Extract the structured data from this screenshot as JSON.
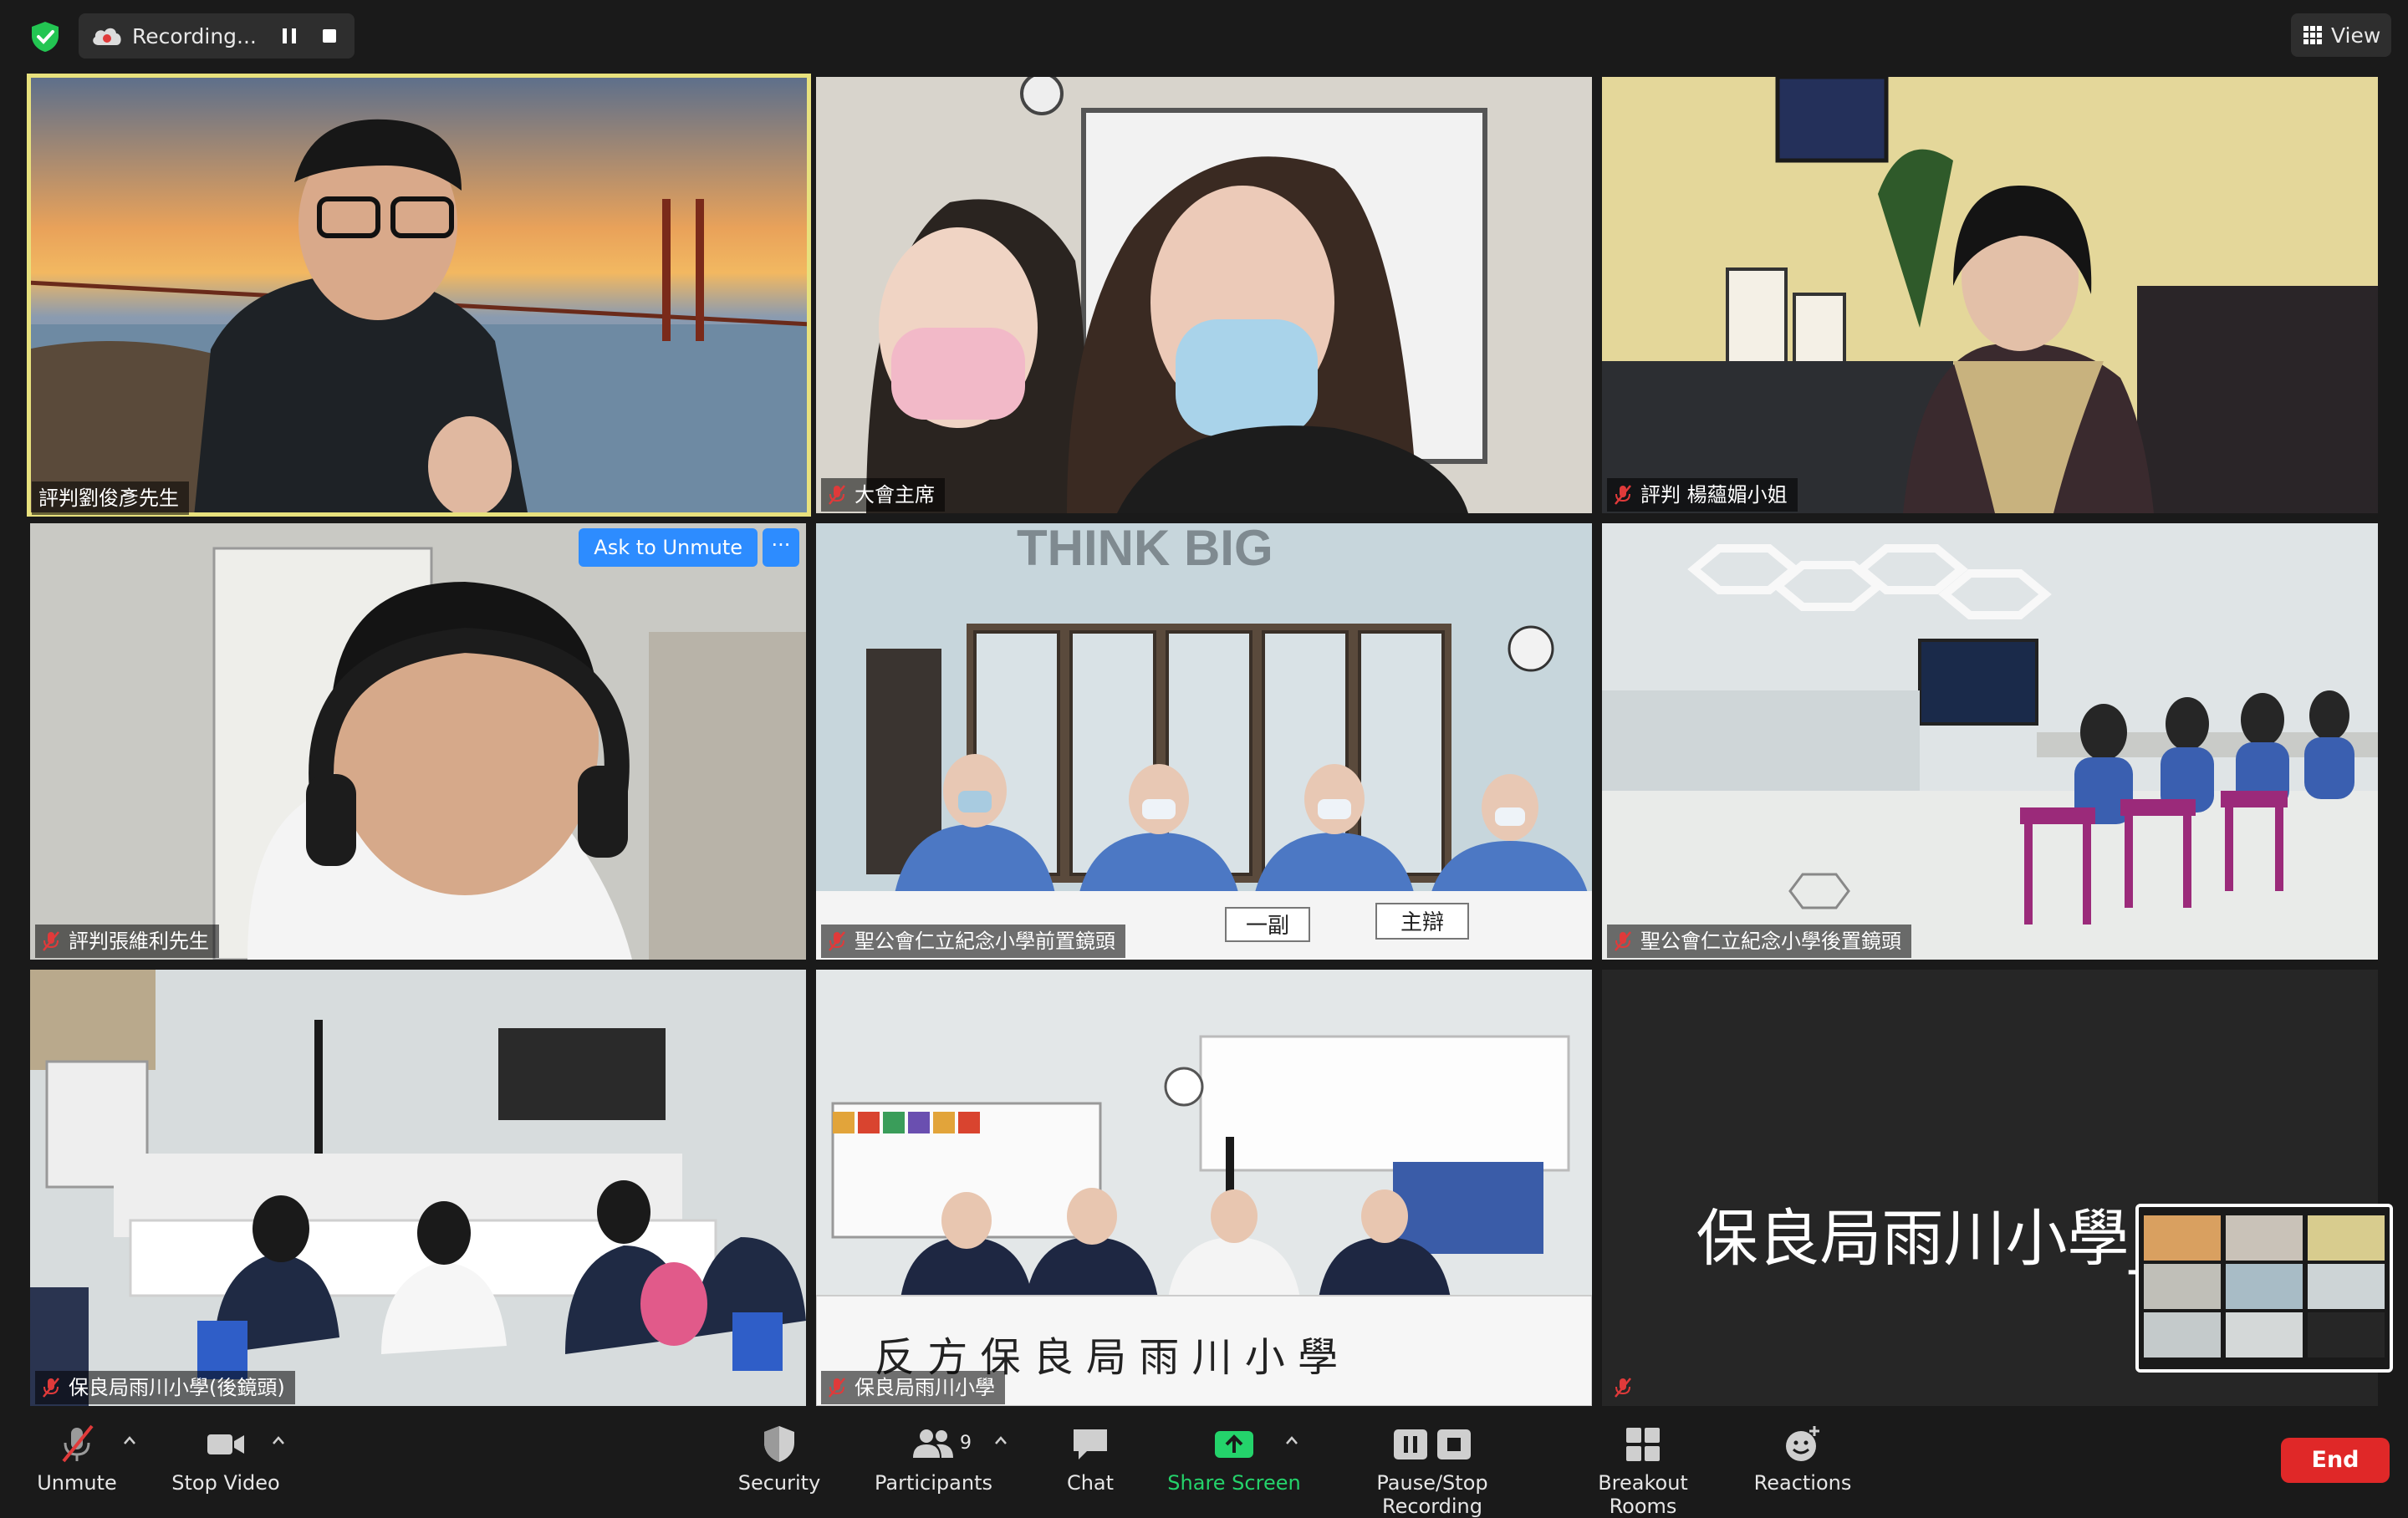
{
  "top_bar": {
    "recording_label": "Recording...",
    "view_label": "View"
  },
  "tiles": [
    {
      "name": "評判劉俊彥先生",
      "muted": false,
      "active_speaker": true
    },
    {
      "name": "大會主席",
      "muted": true
    },
    {
      "name": "評判 楊蘊媚小姐",
      "muted": true
    },
    {
      "name": "評判張維利先生",
      "muted": true,
      "ask_to_unmute": "Ask to Unmute",
      "more": "···"
    },
    {
      "name": "聖公會仁立紀念小學前置鏡頭",
      "muted": true,
      "banner_text": "THINK BIG",
      "desk_signs": [
        "一副",
        "主辯"
      ]
    },
    {
      "name": "聖公會仁立紀念小學後置鏡頭",
      "muted": true
    },
    {
      "name": "保良局雨川小學(後鏡頭)",
      "muted": true
    },
    {
      "name": "保良局雨川小學",
      "muted": true,
      "table_sign": "反 方  保 良 局 雨 川 小 學"
    },
    {
      "name": "",
      "muted": true,
      "display_name": "保良局雨川小學_觀眾"
    }
  ],
  "toolbar": {
    "unmute": "Unmute",
    "stop_video": "Stop Video",
    "security": "Security",
    "participants": "Participants",
    "participants_count": "9",
    "chat": "Chat",
    "share_screen": "Share Screen",
    "pause_stop_recording": "Pause/Stop Recording",
    "breakout_rooms": "Breakout Rooms",
    "reactions": "Reactions",
    "end": "End"
  },
  "colors": {
    "background": "#1a1a1a",
    "active_speaker_border": "#e8e17d",
    "ask_unmute_blue": "#2d8cff",
    "end_red": "#e02828",
    "share_green": "#24d36b",
    "muted_mic_red": "#e03a3a",
    "shield_green": "#23c552"
  }
}
